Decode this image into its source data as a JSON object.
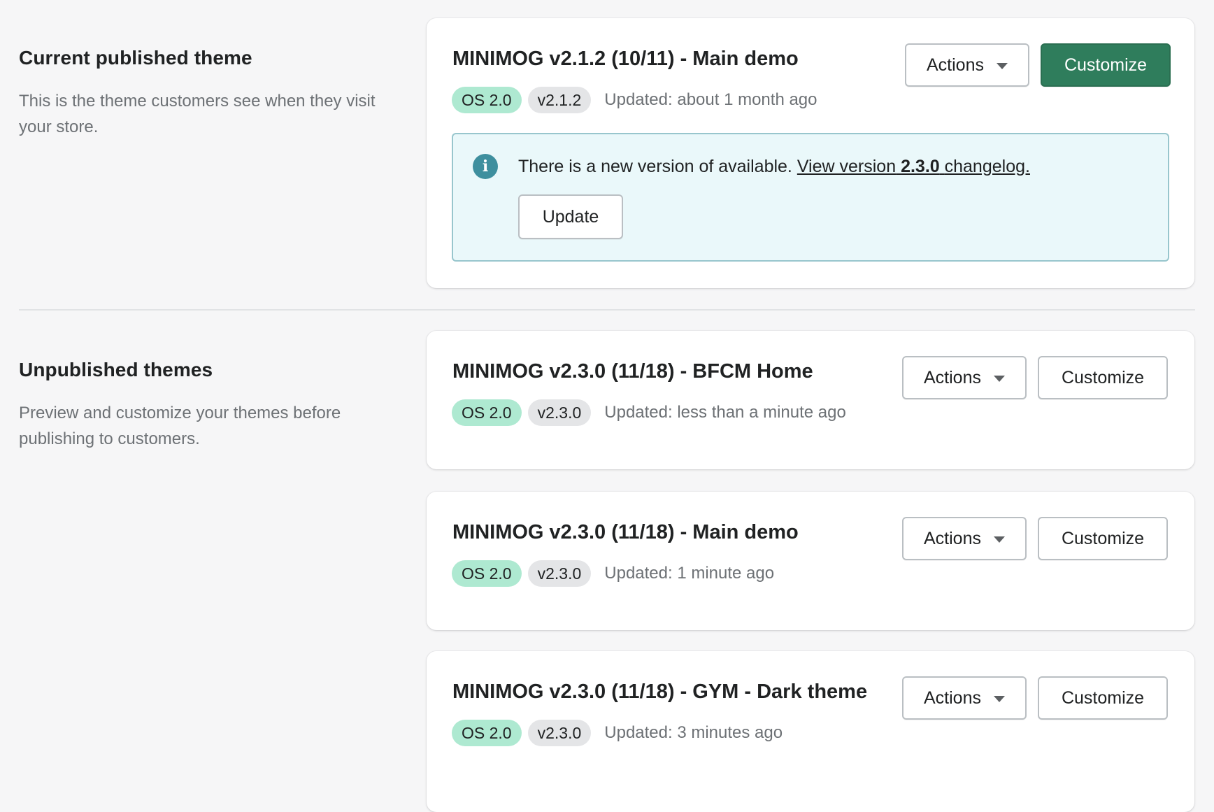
{
  "current": {
    "heading": "Current published theme",
    "description": "This is the theme customers see when they visit your store.",
    "theme": {
      "title": "MINIMOG v2.1.2 (10/11) - Main demo",
      "os_badge": "OS 2.0",
      "version_badge": "v2.1.2",
      "updated": "Updated: about 1 month ago",
      "actions_label": "Actions",
      "customize_label": "Customize"
    },
    "banner": {
      "message": "There is a new version of available.",
      "link_prefix": "View version",
      "link_version": "2.3.0",
      "link_suffix": "changelog.",
      "update_label": "Update"
    }
  },
  "unpublished": {
    "heading": "Unpublished themes",
    "description": "Preview and customize your themes before publishing to customers.",
    "themes": [
      {
        "title": "MINIMOG v2.3.0 (11/18) - BFCM Home",
        "os_badge": "OS 2.0",
        "version_badge": "v2.3.0",
        "updated": "Updated: less than a minute ago",
        "actions_label": "Actions",
        "customize_label": "Customize"
      },
      {
        "title": "MINIMOG v2.3.0 (11/18) - Main demo",
        "os_badge": "OS 2.0",
        "version_badge": "v2.3.0",
        "updated": "Updated: 1 minute ago",
        "actions_label": "Actions",
        "customize_label": "Customize"
      },
      {
        "title": "MINIMOG v2.3.0 (11/18) - GYM - Dark theme",
        "os_badge": "OS 2.0",
        "version_badge": "v2.3.0",
        "updated": "Updated: 3 minutes ago",
        "actions_label": "Actions",
        "customize_label": "Customize"
      }
    ]
  },
  "colors": {
    "primary_button": "#2f7d5c",
    "os_badge": "#aee9d1",
    "version_badge": "#e4e5e7",
    "info_banner_bg": "#eaf8fa",
    "info_banner_border": "#98c6cd",
    "info_icon": "#3e8f9e"
  },
  "icons": {
    "banner": "info-icon",
    "dropdown": "caret-down-icon"
  }
}
